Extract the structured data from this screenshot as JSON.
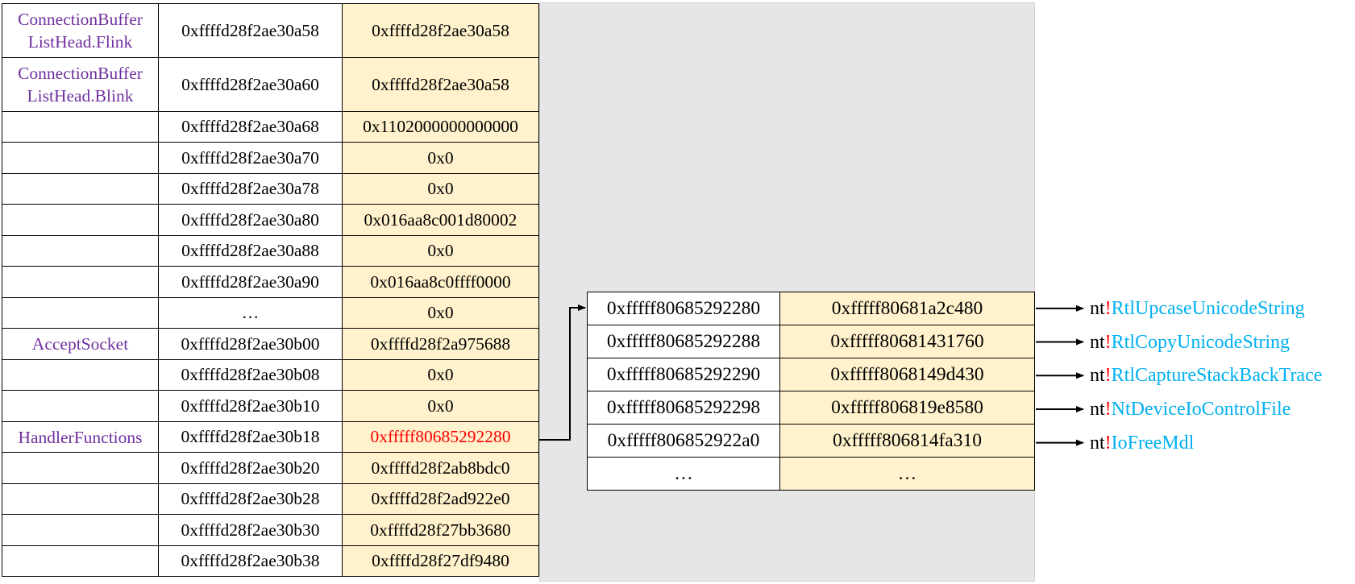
{
  "left_table": {
    "rows": [
      {
        "name": "ConnectionBuffer ListHead.Flink",
        "address": "0xffffd28f2ae30a58",
        "value": "0xffffd28f2ae30a58"
      },
      {
        "name": "ConnectionBuffer ListHead.Blink",
        "address": "0xffffd28f2ae30a60",
        "value": "0xffffd28f2ae30a58"
      },
      {
        "name": "",
        "address": "0xffffd28f2ae30a68",
        "value": "0x1102000000000000"
      },
      {
        "name": "",
        "address": "0xffffd28f2ae30a70",
        "value": "0x0"
      },
      {
        "name": "",
        "address": "0xffffd28f2ae30a78",
        "value": "0x0"
      },
      {
        "name": "",
        "address": "0xffffd28f2ae30a80",
        "value": "0x016aa8c001d80002"
      },
      {
        "name": "",
        "address": "0xffffd28f2ae30a88",
        "value": "0x0"
      },
      {
        "name": "",
        "address": "0xffffd28f2ae30a90",
        "value": "0x016aa8c0ffff0000"
      },
      {
        "name": "",
        "address": "…",
        "value": "0x0"
      },
      {
        "name": "AcceptSocket",
        "address": "0xffffd28f2ae30b00",
        "value": "0xffffd28f2a975688"
      },
      {
        "name": "",
        "address": "0xffffd28f2ae30b08",
        "value": "0x0"
      },
      {
        "name": "",
        "address": "0xffffd28f2ae30b10",
        "value": "0x0"
      },
      {
        "name": "HandlerFunctions",
        "address": "0xffffd28f2ae30b18",
        "value": "0xfffff80685292280",
        "highlight": true
      },
      {
        "name": "",
        "address": "0xffffd28f2ae30b20",
        "value": "0xffffd28f2ab8bdc0"
      },
      {
        "name": "",
        "address": "0xffffd28f2ae30b28",
        "value": "0xffffd28f2ad922e0"
      },
      {
        "name": "",
        "address": "0xffffd28f2ae30b30",
        "value": "0xffffd28f27bb3680"
      },
      {
        "name": "",
        "address": "0xffffd28f2ae30b38",
        "value": "0xffffd28f27df9480"
      }
    ]
  },
  "right_table": {
    "rows": [
      {
        "address": "0xfffff80685292280",
        "value": "0xfffff80681a2c480",
        "module": "nt",
        "function": "RtlUpcaseUnicodeString"
      },
      {
        "address": "0xfffff80685292288",
        "value": "0xfffff80681431760",
        "module": "nt",
        "function": "RtlCopyUnicodeString"
      },
      {
        "address": "0xfffff80685292290",
        "value": "0xfffff8068149d430",
        "module": "nt",
        "function": "RtlCaptureStackBackTrace"
      },
      {
        "address": "0xfffff80685292298",
        "value": "0xfffff806819e8580",
        "module": "nt",
        "function": "NtDeviceIoControlFile"
      },
      {
        "address": "0xfffff806852922a0",
        "value": "0xfffff806814fa310",
        "module": "nt",
        "function": "IoFreeMdl"
      },
      {
        "address": "…",
        "value": "…"
      }
    ]
  },
  "symbol_separator": "!",
  "colors": {
    "field_name": "#7030a0",
    "value_cell_bg": "#fff2cc",
    "highlight_value": "#ff0000",
    "symbol_bang": "#ff0000",
    "function_name": "#00b0f0",
    "panel_bg": "#e6e6e6"
  }
}
